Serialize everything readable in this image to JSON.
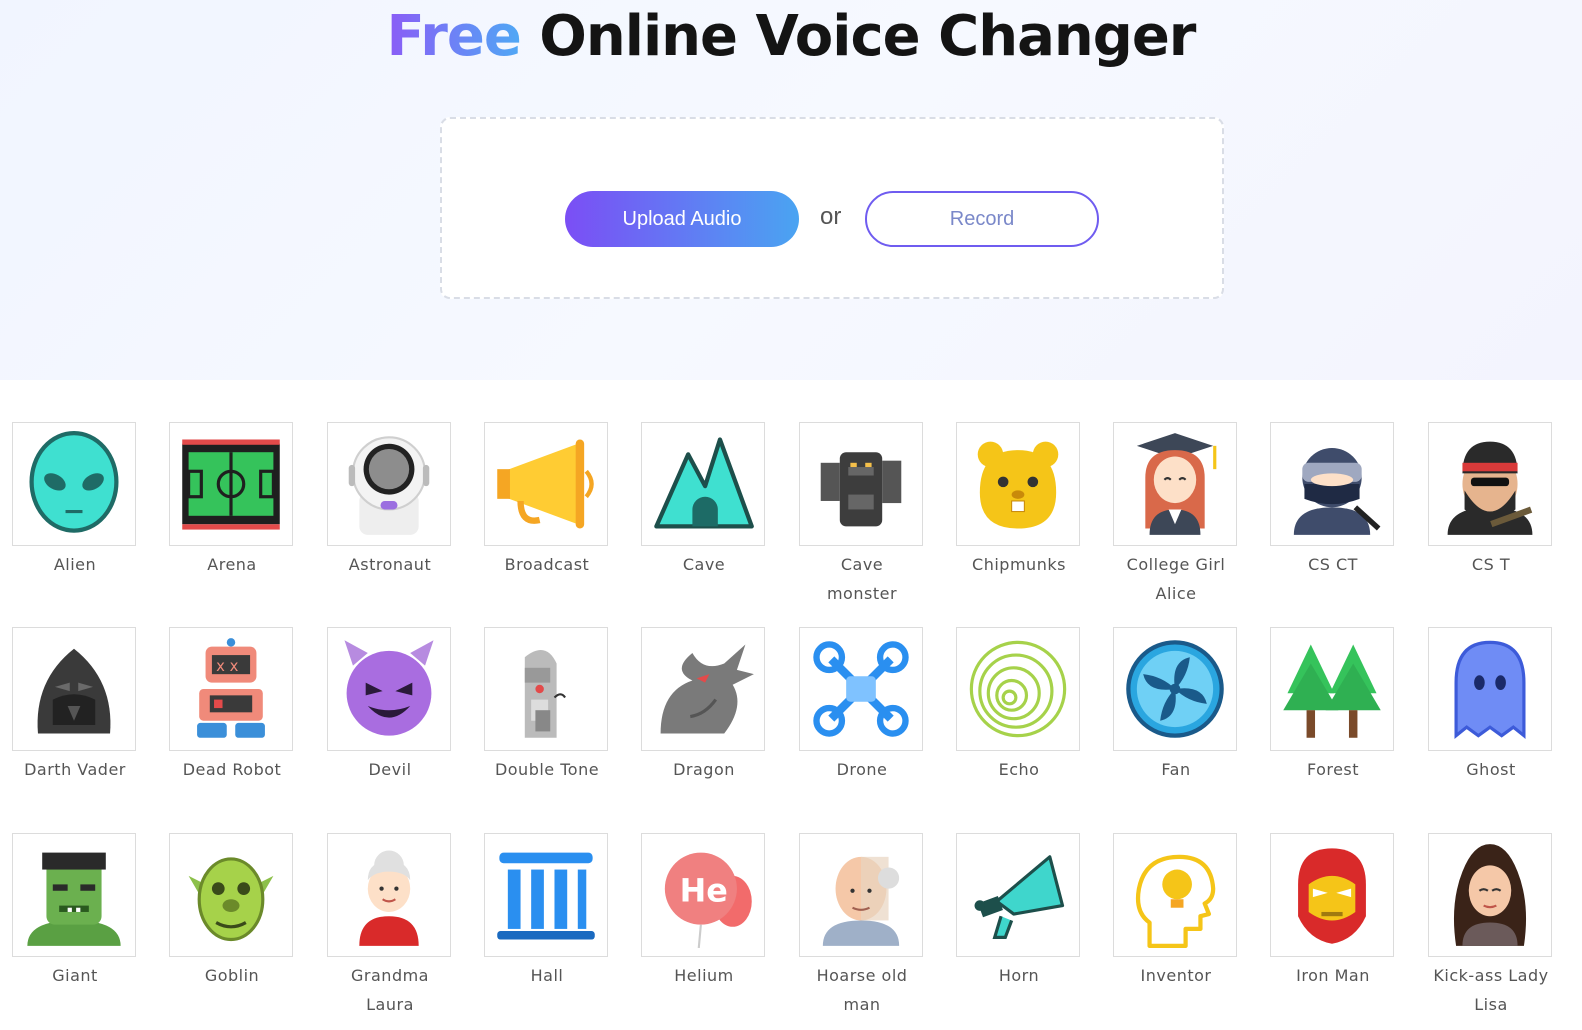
{
  "header": {
    "title_accent": "Free",
    "title_rest": "Online Voice Changer"
  },
  "upload": {
    "upload_label": "Upload Audio",
    "or_label": "or",
    "record_label": "Record"
  },
  "colors": {
    "accent_start": "#7b4ef5",
    "accent_end": "#4aa4f2"
  },
  "voices": [
    {
      "label": "Alien",
      "icon": "alien-icon"
    },
    {
      "label": "Arena",
      "icon": "arena-icon"
    },
    {
      "label": "Astronaut",
      "icon": "astronaut-icon"
    },
    {
      "label": "Broadcast",
      "icon": "broadcast-icon"
    },
    {
      "label": "Cave",
      "icon": "cave-icon"
    },
    {
      "label": "Cave\nmonster",
      "icon": "cave-monster-icon"
    },
    {
      "label": "Chipmunks",
      "icon": "chipmunks-icon"
    },
    {
      "label": "College Girl\nAlice",
      "icon": "college-girl-icon"
    },
    {
      "label": "CS CT",
      "icon": "cs-ct-icon"
    },
    {
      "label": "CS T",
      "icon": "cs-t-icon"
    },
    {
      "label": "Darth Vader",
      "icon": "darth-vader-icon"
    },
    {
      "label": "Dead Robot",
      "icon": "dead-robot-icon"
    },
    {
      "label": "Devil",
      "icon": "devil-icon"
    },
    {
      "label": "Double Tone",
      "icon": "double-tone-icon"
    },
    {
      "label": "Dragon",
      "icon": "dragon-icon"
    },
    {
      "label": "Drone",
      "icon": "drone-icon"
    },
    {
      "label": "Echo",
      "icon": "echo-icon"
    },
    {
      "label": "Fan",
      "icon": "fan-icon"
    },
    {
      "label": "Forest",
      "icon": "forest-icon"
    },
    {
      "label": "Ghost",
      "icon": "ghost-icon"
    },
    {
      "label": "Giant",
      "icon": "giant-icon"
    },
    {
      "label": "Goblin",
      "icon": "goblin-icon"
    },
    {
      "label": "Grandma\nLaura",
      "icon": "grandma-icon"
    },
    {
      "label": "Hall",
      "icon": "hall-icon"
    },
    {
      "label": "Helium",
      "icon": "helium-icon",
      "icon_text": "He"
    },
    {
      "label": "Hoarse old\nman",
      "icon": "old-man-icon"
    },
    {
      "label": "Horn",
      "icon": "horn-icon"
    },
    {
      "label": "Inventor",
      "icon": "inventor-icon"
    },
    {
      "label": "Iron Man",
      "icon": "iron-man-icon"
    },
    {
      "label": "Kick-ass Lady\nLisa",
      "icon": "lady-icon"
    }
  ]
}
